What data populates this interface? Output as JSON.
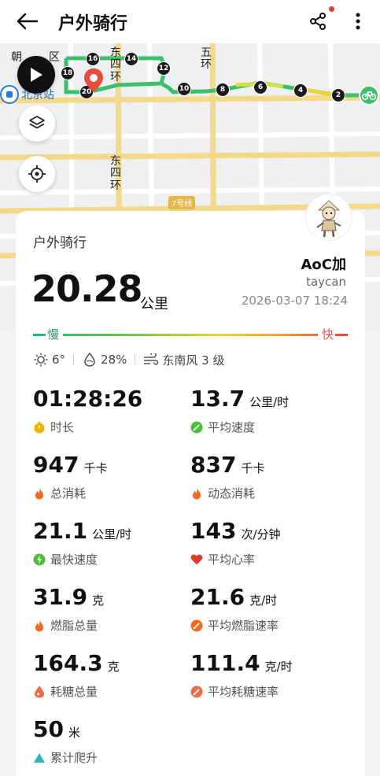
{
  "header": {
    "title": "户外骑行",
    "back_icon": "back-arrow-icon",
    "share_icon": "share-icon",
    "more_icon": "more-vertical-icon"
  },
  "map": {
    "labels": {
      "chao": "朝",
      "qu": "区",
      "station": "北京站",
      "east4_top_a": "东",
      "east4_top_b": "四",
      "east4_top_c": "环",
      "fifth_a": "五",
      "fifth_b": "环",
      "east4_mid_a": "东",
      "east4_mid_b": "四",
      "east4_mid_c": "环",
      "road_badge": "7号线"
    },
    "route_markers": [
      "16",
      "14",
      "18",
      "12",
      "20",
      "10",
      "8",
      "6",
      "4",
      "2"
    ],
    "colors": {
      "route_green": "#3cc06b",
      "route_yellow": "#e9d43a"
    }
  },
  "summary": {
    "sport": "户外骑行",
    "distance": "20.28",
    "distance_unit": "公里",
    "username": "AoC加",
    "device": "taycan",
    "datetime": "2026-03-07 18:24"
  },
  "speed_legend": {
    "slow": "慢",
    "fast": "快"
  },
  "weather": {
    "temperature": "6°",
    "humidity": "28%",
    "wind": "东南风 3 级"
  },
  "stats": [
    {
      "value": "01:28:26",
      "unit": "",
      "label": "时长",
      "icon": "stopwatch-icon",
      "color": "#f0b400"
    },
    {
      "value": "13.7",
      "unit": "公里/时",
      "label": "平均速度",
      "icon": "speedometer-icon",
      "color": "#4cbf3a"
    },
    {
      "value": "947",
      "unit": "千卡",
      "label": "总消耗",
      "icon": "flame-icon",
      "color": "#f26b1d"
    },
    {
      "value": "837",
      "unit": "千卡",
      "label": "动态消耗",
      "icon": "flame-icon",
      "color": "#f26b1d"
    },
    {
      "value": "21.1",
      "unit": "公里/时",
      "label": "最快速度",
      "icon": "lightning-icon",
      "color": "#4cbf3a"
    },
    {
      "value": "143",
      "unit": "次/分钟",
      "label": "平均心率",
      "icon": "heart-icon",
      "color": "#e53935"
    },
    {
      "value": "31.9",
      "unit": "克",
      "label": "燃脂总量",
      "icon": "fat-flame-icon",
      "color": "#f26b1d"
    },
    {
      "value": "21.6",
      "unit": "克/时",
      "label": "平均燃脂速率",
      "icon": "fat-rate-icon",
      "color": "#f26b1d"
    },
    {
      "value": "164.3",
      "unit": "克",
      "label": "耗糖总量",
      "icon": "sugar-drop-icon",
      "color": "#ee6b4d"
    },
    {
      "value": "111.4",
      "unit": "克/时",
      "label": "平均耗糖速率",
      "icon": "sugar-rate-icon",
      "color": "#ee6b4d"
    },
    {
      "value": "50",
      "unit": "米",
      "label": "累计爬升",
      "icon": "ascent-triangle-icon",
      "color": "#2bb5b5"
    }
  ]
}
